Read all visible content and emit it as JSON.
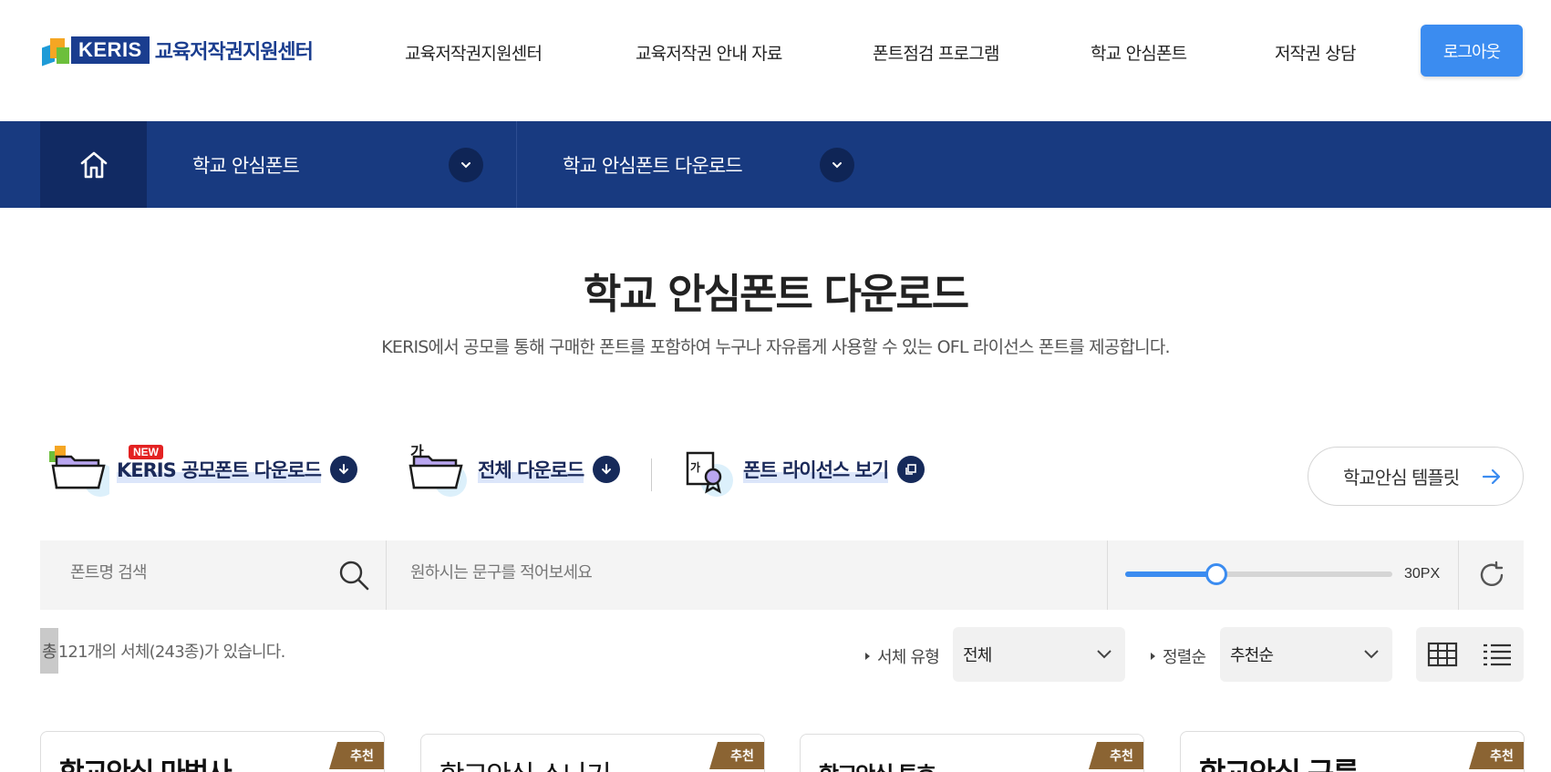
{
  "header": {
    "logo_brand": "KERIS",
    "logo_text": "교육저작권지원센터",
    "nav": [
      "교육저작권지원센터",
      "교육저작권 안내 자료",
      "폰트점검 프로그램",
      "학교 안심폰트",
      "저작권 상담"
    ],
    "logout_label": "로그아웃"
  },
  "breadcrumb": {
    "level1": "학교 안심폰트",
    "level2": "학교 안심폰트 다운로드"
  },
  "page": {
    "title": "학교 안심폰트 다운로드",
    "subtitle": "KERIS에서 공모를 통해 구매한 폰트를 포함하여 누구나 자유롭게 사용할 수 있는 OFL 라이선스 폰트를 제공합니다."
  },
  "actions": {
    "new_badge": "NEW",
    "keris_download": "KERIS 공모폰트 다운로드",
    "all_download": "전체 다운로드",
    "license": "폰트 라이선스 보기",
    "template_btn": "학교안심 템플릿"
  },
  "search": {
    "font_name_placeholder": "폰트명 검색",
    "phrase_placeholder": "원하시는 문구를 적어보세요",
    "size_value": "30PX",
    "size_fraction": 0.34
  },
  "filters": {
    "count_prefix": "총",
    "count_text": " 121개의 서체(243종)가 있습니다.",
    "type_label": "서체 유형",
    "type_value": "전체",
    "sort_label": "정렬순",
    "sort_value": "추천순"
  },
  "cards": [
    {
      "name": "학교안심 마법사",
      "badge": "추천"
    },
    {
      "name": "학교안심 소나기",
      "badge": "추천"
    },
    {
      "name": "학교안심 투호",
      "badge": "추천"
    },
    {
      "name": "학교안심 구름",
      "badge": "추천"
    }
  ],
  "colors": {
    "primary_navy": "#183a80",
    "accent_blue": "#3b8cf0",
    "badge_brown": "#8b6433"
  }
}
